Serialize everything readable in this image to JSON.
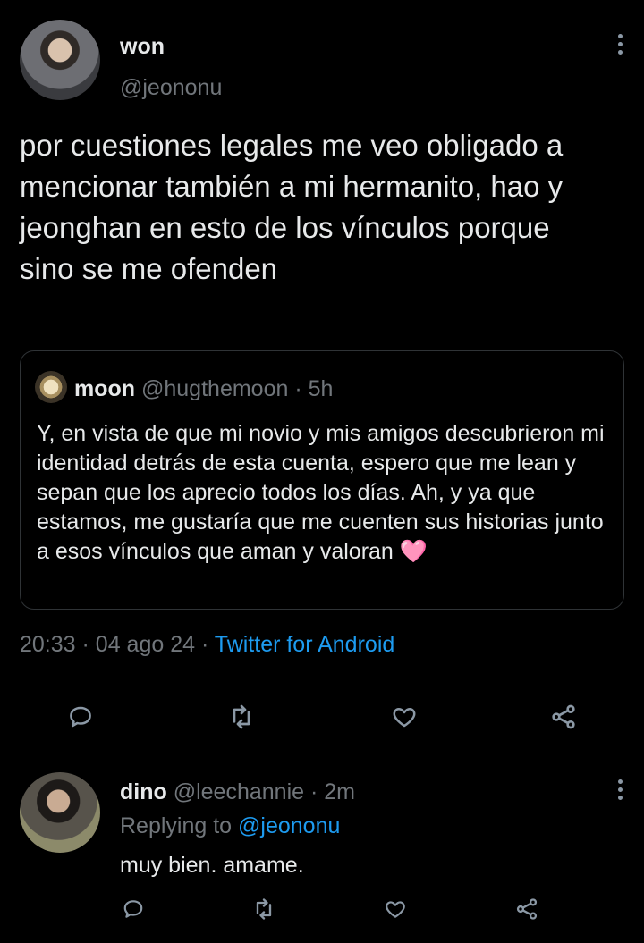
{
  "main_tweet": {
    "display_name": "won",
    "handle": "@jeononu",
    "text": "por cuestiones legales me veo obligado a mencionar también a mi hermanito, hao y jeonghan en esto de los vínculos porque sino se me ofenden",
    "time": "20:33",
    "separator1": "·",
    "date": "04 ago 24",
    "separator2": "·",
    "source": "Twitter for Android"
  },
  "quoted_tweet": {
    "display_name": "moon",
    "handle": "@hugthemoon",
    "separator": "·",
    "time_ago": "5h",
    "text": "Y, en vista de que mi novio y mis amigos descubrieron mi identidad detrás de esta cuenta, espero que me lean y sepan que los aprecio todos los días. Ah, y ya que estamos, me gustaría que me cuenten sus historias junto a esos vínculos que aman y valoran",
    "emoji": "🩷"
  },
  "reply": {
    "display_name": "dino",
    "handle": "@leechannie",
    "separator": "·",
    "time_ago": "2m",
    "replying_prefix": "Replying to",
    "replying_to": "@jeononu",
    "text": "muy bien. amame."
  },
  "icons": [
    "reply-icon",
    "retweet-icon",
    "like-icon",
    "share-icon",
    "more-icon"
  ],
  "colors": {
    "background": "#000000",
    "text": "#e7e9ea",
    "muted": "#71767b",
    "link": "#1d9bf0",
    "divider": "#2f3336"
  }
}
